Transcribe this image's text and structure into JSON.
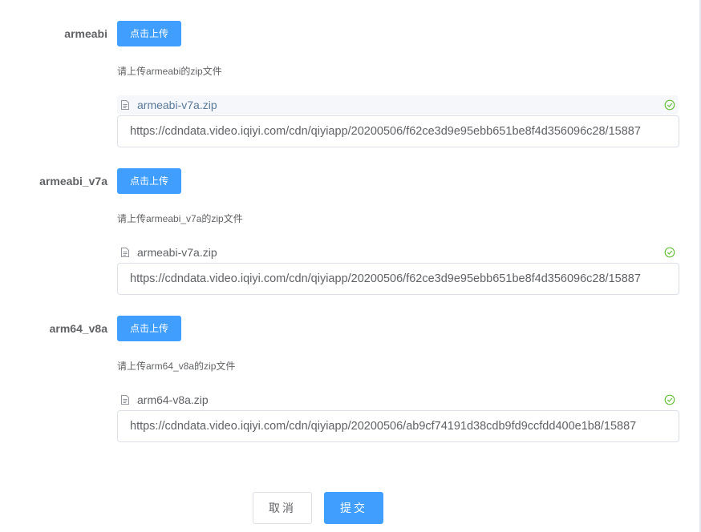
{
  "sections": [
    {
      "label": "armeabi",
      "upload_label": "点击上传",
      "tip": "请上传armeabi的zip文件",
      "file_name": "armeabi-v7a.zip",
      "url": "https://cdndata.video.iqiyi.com/cdn/qiyiapp/20200506/f62ce3d9e95ebb651be8f4d356096c28/15887"
    },
    {
      "label": "armeabi_v7a",
      "upload_label": "点击上传",
      "tip": "请上传armeabi_v7a的zip文件",
      "file_name": "armeabi-v7a.zip",
      "url": "https://cdndata.video.iqiyi.com/cdn/qiyiapp/20200506/f62ce3d9e95ebb651be8f4d356096c28/15887"
    },
    {
      "label": "arm64_v8a",
      "upload_label": "点击上传",
      "tip": "请上传arm64_v8a的zip文件",
      "file_name": "arm64-v8a.zip",
      "url": "https://cdndata.video.iqiyi.com/cdn/qiyiapp/20200506/ab9cf74191d38cdb9fd9ccfdd400e1b8/15887"
    }
  ],
  "actions": {
    "cancel_label": "取消",
    "submit_label": "提交"
  },
  "colors": {
    "primary": "#409eff",
    "success": "#67c23a",
    "text": "#606266",
    "border": "#dcdfe6"
  },
  "icons": {
    "file": "document-icon",
    "status": "check-circle-icon"
  }
}
